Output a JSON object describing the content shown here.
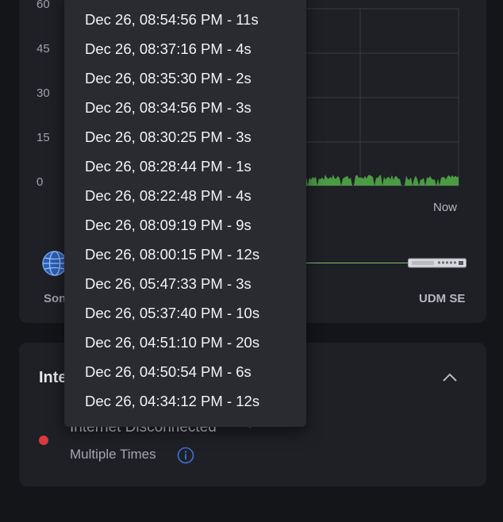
{
  "chart": {
    "y_ticks": [
      "60",
      "45",
      "30",
      "15",
      "0"
    ],
    "end_label": "Now",
    "fill_color": "#4b9a44",
    "grid_color": "#3a3c43"
  },
  "topology": {
    "source_label": "Son",
    "device_label": "UDM SE"
  },
  "section": {
    "title": "Inte",
    "event_title": "Internet Disconnected",
    "event_subtitle": "Multiple Times",
    "status_color": "#d9383c",
    "info_color": "#3a73d9"
  },
  "dropdown": {
    "items": [
      "Dec 26, 08:54:56 PM - 11s",
      "Dec 26, 08:37:16 PM - 4s",
      "Dec 26, 08:35:30 PM - 2s",
      "Dec 26, 08:34:56 PM - 3s",
      "Dec 26, 08:30:25 PM - 3s",
      "Dec 26, 08:28:44 PM - 1s",
      "Dec 26, 08:22:48 PM - 4s",
      "Dec 26, 08:09:19 PM - 9s",
      "Dec 26, 08:00:15 PM - 12s",
      "Dec 26, 05:47:33 PM - 3s",
      "Dec 26, 05:37:40 PM - 10s",
      "Dec 26, 04:51:10 PM - 20s",
      "Dec 26, 04:50:54 PM - 6s",
      "Dec 26, 04:34:12 PM - 12s"
    ]
  }
}
